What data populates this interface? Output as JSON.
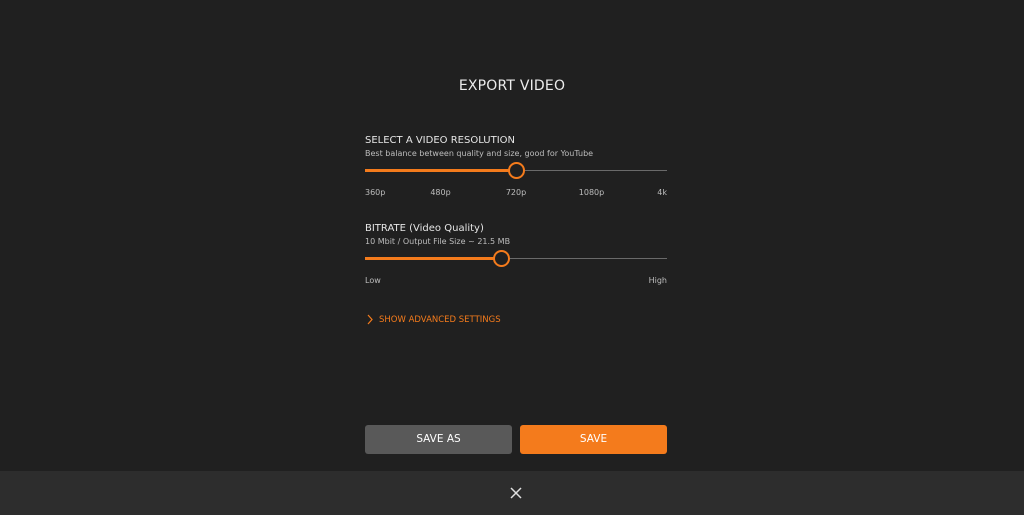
{
  "dialog": {
    "title": "EXPORT VIDEO"
  },
  "resolution": {
    "title": "SELECT A VIDEO RESOLUTION",
    "description": "Best balance between quality and size, good for YouTube",
    "options": [
      "360p",
      "480p",
      "720p",
      "1080p",
      "4k"
    ],
    "selected_index": 2,
    "selected_value": "720p"
  },
  "bitrate": {
    "title": "BITRATE (Video Quality)",
    "description": "10 Mbit / Output File Size ~ 21.5 MB",
    "min_label": "Low",
    "max_label": "High",
    "value_fraction": 0.45
  },
  "advanced": {
    "label": "SHOW ADVANCED SETTINGS",
    "icon": "chevron-right-icon"
  },
  "buttons": {
    "save_as": "SAVE AS",
    "save": "SAVE"
  },
  "footer": {
    "close_icon": "close-icon"
  },
  "colors": {
    "accent": "#f47b1c",
    "background": "#202020",
    "footer": "#2d2d2d",
    "secondary_button": "#595959"
  }
}
